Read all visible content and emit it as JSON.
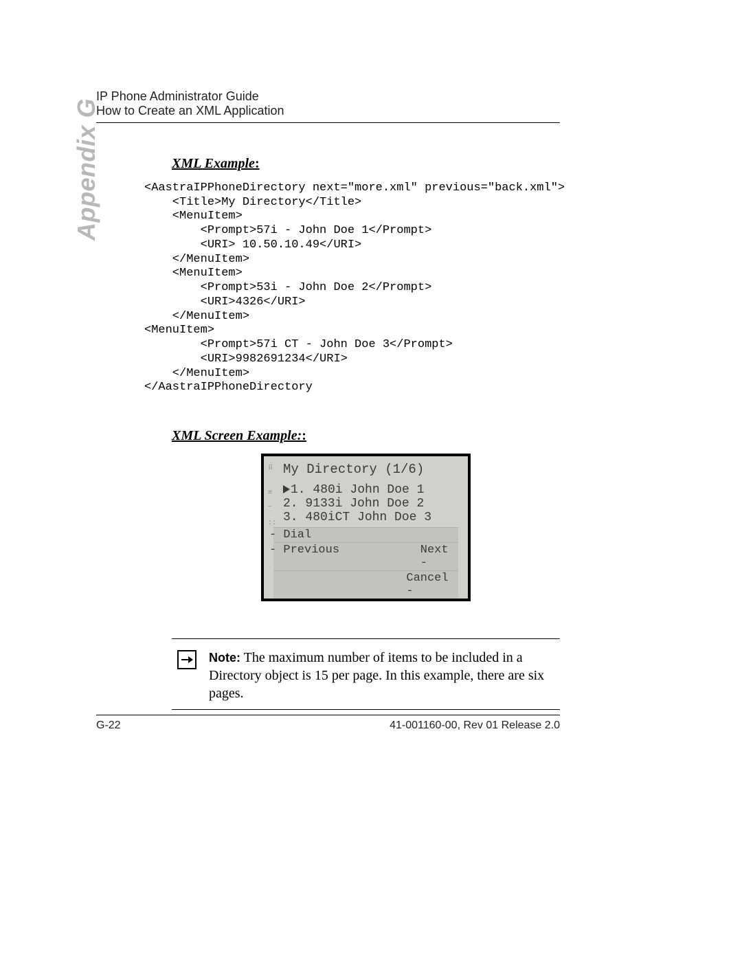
{
  "header": {
    "line1": "IP Phone Administrator Guide",
    "line2": "How to Create an XML Application"
  },
  "side_label": "Appendix G",
  "sections": {
    "xml_example_heading": "XML Example",
    "xml_screen_heading": "XML Screen Example:"
  },
  "code": {
    "l1": "<AastraIPPhoneDirectory next=\"more.xml\" previous=\"back.xml\">",
    "l2": "    <Title>My Directory</Title>",
    "l3": "    <MenuItem>",
    "l4": "        <Prompt>57i - John Doe 1</Prompt>",
    "l5": "        <URI> 10.50.10.49</URI>",
    "l6": "    </MenuItem>",
    "l7": "    <MenuItem>",
    "l8": "        <Prompt>53i - John Doe 2</Prompt>",
    "l9": "        <URI>4326</URI>",
    "l10": "    </MenuItem>",
    "l11": "<MenuItem>",
    "l12": "        <Prompt>57i CT - John Doe 3</Prompt>",
    "l13": "        <URI>9982691234</URI>",
    "l14": "    </MenuItem>",
    "l15": "</AastraIPPhoneDirectory"
  },
  "screen": {
    "title": "My Directory (1/6)",
    "row1": "1. 480i John Doe 1",
    "row2": " 2. 9133i John Doe 2",
    "row3": " 3. 480iCT John Doe 3",
    "soft_dial": "Dial",
    "soft_prev": "Previous",
    "soft_next": "Next",
    "soft_cancel": "Cancel"
  },
  "note": {
    "label": "Note:",
    "text": " The maximum number of items to be included in a Directory object is 15 per page. In this example, there are six pages."
  },
  "footer": {
    "page": "G-22",
    "doc": "41-001160-00, Rev 01  Release 2.0"
  }
}
